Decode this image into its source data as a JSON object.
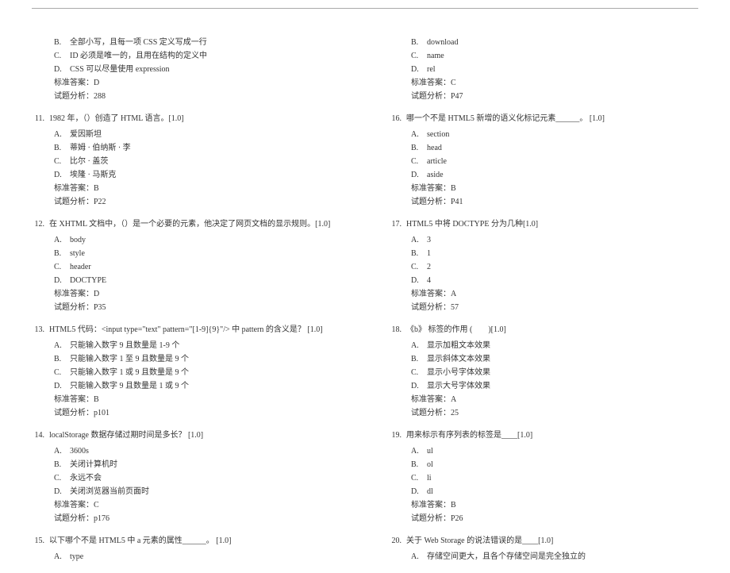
{
  "leftColumn": {
    "partialQuestion": {
      "options": [
        {
          "letter": "B.",
          "text": "全部小写，且每一项 CSS 定义写成一行"
        },
        {
          "letter": "C.",
          "text": "ID 必须是唯一的，且用在结构的定义中"
        },
        {
          "letter": "D.",
          "text": "CSS 可以尽量使用 expression"
        }
      ],
      "answerLabel": "标准答案：",
      "answerValue": "D",
      "analysisLabel": "试题分析：",
      "analysisValue": "288"
    },
    "questions": [
      {
        "num": "11.",
        "text": "1982 年，（）创造了 HTML 语言。[1.0]",
        "options": [
          {
            "letter": "A.",
            "text": "爱因斯坦"
          },
          {
            "letter": "B.",
            "text": "蒂姆 · 伯纳斯 · 李"
          },
          {
            "letter": "C.",
            "text": "比尔 · 盖茨"
          },
          {
            "letter": "D.",
            "text": "埃隆 · 马斯克"
          }
        ],
        "answerLabel": "标准答案：",
        "answerValue": "B",
        "analysisLabel": "试题分析：",
        "analysisValue": "P22"
      },
      {
        "num": "12.",
        "text": "在 XHTML 文档中，（）是一个必要的元素，他决定了网页文档的显示规则。[1.0]",
        "options": [
          {
            "letter": "A.",
            "text": "body"
          },
          {
            "letter": "B.",
            "text": "style"
          },
          {
            "letter": "C.",
            "text": "header"
          },
          {
            "letter": "D.",
            "text": "DOCTYPE"
          }
        ],
        "answerLabel": "标准答案：",
        "answerValue": "D",
        "analysisLabel": "试题分析：",
        "analysisValue": "P35"
      },
      {
        "num": "13.",
        "text": "HTML5 代码：<input type=\"text\" pattern=\"[1-9]{9}\"/> 中 pattern 的含义是？ [1.0]",
        "options": [
          {
            "letter": "A.",
            "text": "只能输入数字 9 且数量是 1-9 个"
          },
          {
            "letter": "B.",
            "text": "只能输入数字 1 至 9 且数量是 9 个"
          },
          {
            "letter": "C.",
            "text": "只能输入数字 1 或 9 且数量是 9 个"
          },
          {
            "letter": "D.",
            "text": "只能输入数字 9 且数量是 1 或 9 个"
          }
        ],
        "answerLabel": "标准答案：",
        "answerValue": "B",
        "analysisLabel": "试题分析：",
        "analysisValue": "p101"
      },
      {
        "num": "14.",
        "text": "localStorage 数据存储过期时间是多长？ [1.0]",
        "options": [
          {
            "letter": "A.",
            "text": "3600s"
          },
          {
            "letter": "B.",
            "text": "关闭计算机时"
          },
          {
            "letter": "C.",
            "text": "永远不会"
          },
          {
            "letter": "D.",
            "text": "关闭浏览器当前页面时"
          }
        ],
        "answerLabel": "标准答案：",
        "answerValue": "C",
        "analysisLabel": "试题分析：",
        "analysisValue": "p176"
      },
      {
        "num": "15.",
        "text": "以下哪个不是 HTML5 中 a 元素的属性______。 [1.0]",
        "options": [
          {
            "letter": "A.",
            "text": "type"
          }
        ]
      }
    ]
  },
  "rightColumn": {
    "partialQuestion": {
      "options": [
        {
          "letter": "B.",
          "text": "download"
        },
        {
          "letter": "C.",
          "text": "name"
        },
        {
          "letter": "D.",
          "text": "rel"
        }
      ],
      "answerLabel": "标准答案：",
      "answerValue": "C",
      "analysisLabel": "试题分析：",
      "analysisValue": "P47"
    },
    "questions": [
      {
        "num": "16.",
        "text": "哪一个不是 HTML5 新增的语义化标记元素______。 [1.0]",
        "options": [
          {
            "letter": "A.",
            "text": "section"
          },
          {
            "letter": "B.",
            "text": "head"
          },
          {
            "letter": "C.",
            "text": "article"
          },
          {
            "letter": "D.",
            "text": "aside"
          }
        ],
        "answerLabel": "标准答案：",
        "answerValue": "B",
        "analysisLabel": "试题分析：",
        "analysisValue": "P41"
      },
      {
        "num": "17.",
        "text": "HTML5 中将 DOCTYPE 分为几种[1.0]",
        "options": [
          {
            "letter": "A.",
            "text": "3"
          },
          {
            "letter": "B.",
            "text": "1"
          },
          {
            "letter": "C.",
            "text": "2"
          },
          {
            "letter": "D.",
            "text": "4"
          }
        ],
        "answerLabel": "标准答案：",
        "answerValue": "A",
        "analysisLabel": "试题分析：",
        "analysisValue": "57"
      },
      {
        "num": "18.",
        "text": "《b》 标签的作用 (　　)[1.0]",
        "options": [
          {
            "letter": "A.",
            "text": "显示加粗文本效果"
          },
          {
            "letter": "B.",
            "text": "显示斜体文本效果"
          },
          {
            "letter": "C.",
            "text": "显示小号字体效果"
          },
          {
            "letter": "D.",
            "text": "显示大号字体效果"
          }
        ],
        "answerLabel": "标准答案：",
        "answerValue": "A",
        "analysisLabel": "试题分析：",
        "analysisValue": "25"
      },
      {
        "num": "19.",
        "text": "用来标示有序列表的标签是____[1.0]",
        "options": [
          {
            "letter": "A.",
            "text": "ul"
          },
          {
            "letter": "B.",
            "text": "ol"
          },
          {
            "letter": "C.",
            "text": "li"
          },
          {
            "letter": "D.",
            "text": "dl"
          }
        ],
        "answerLabel": "标准答案：",
        "answerValue": "B",
        "analysisLabel": "试题分析：",
        "analysisValue": "P26"
      },
      {
        "num": "20.",
        "text": "关于 Web Storage 的说法错误的是____[1.0]",
        "options": [
          {
            "letter": "A.",
            "text": "存储空间更大，且各个存储空间是完全独立的"
          }
        ]
      }
    ]
  }
}
